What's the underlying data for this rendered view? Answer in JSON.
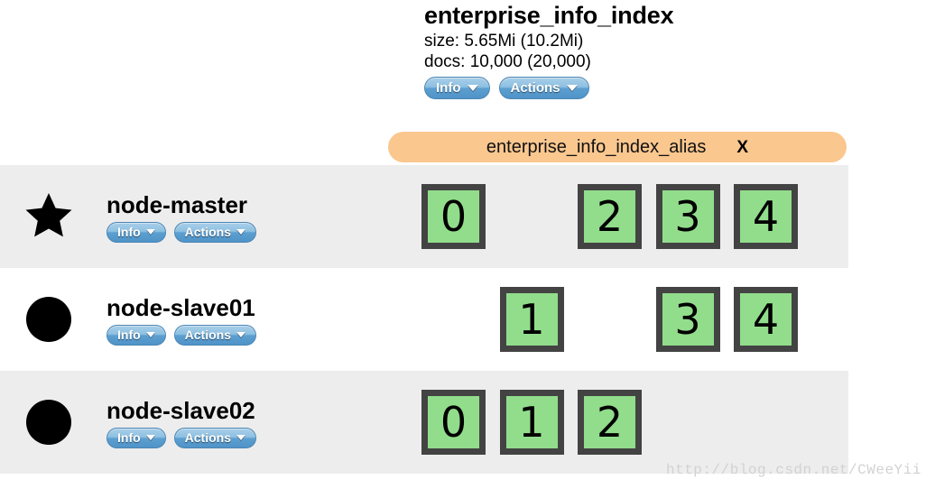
{
  "index": {
    "title": "enterprise_info_index",
    "size_line": "size: 5.65Mi (10.2Mi)",
    "docs_line": "docs: 10,000 (20,000)",
    "info_button": "Info",
    "actions_button": "Actions",
    "alias": {
      "name": "enterprise_info_index_alias",
      "close_label": "X"
    }
  },
  "columns": 5,
  "nodes": [
    {
      "name": "node-master",
      "marker": "star-icon",
      "is_master": true,
      "row_style": "shaded",
      "info_button": "Info",
      "actions_button": "Actions",
      "shards": [
        "0",
        "",
        "2",
        "3",
        "4"
      ]
    },
    {
      "name": "node-slave01",
      "marker": "circle-icon",
      "is_master": false,
      "row_style": "plain",
      "info_button": "Info",
      "actions_button": "Actions",
      "shards": [
        "",
        "1",
        "",
        "3",
        "4"
      ]
    },
    {
      "name": "node-slave02",
      "marker": "circle-icon",
      "is_master": false,
      "row_style": "shaded",
      "info_button": "Info",
      "actions_button": "Actions",
      "shards": [
        "0",
        "1",
        "2",
        "",
        ""
      ]
    }
  ],
  "colors": {
    "shard_fill": "#92dd8c",
    "shard_border": "#434343",
    "alias_bg": "#fac78f",
    "row_shaded": "#ededed",
    "button_blue": "#5d9fd0"
  },
  "watermark": "http://blog.csdn.net/CWeeYii"
}
